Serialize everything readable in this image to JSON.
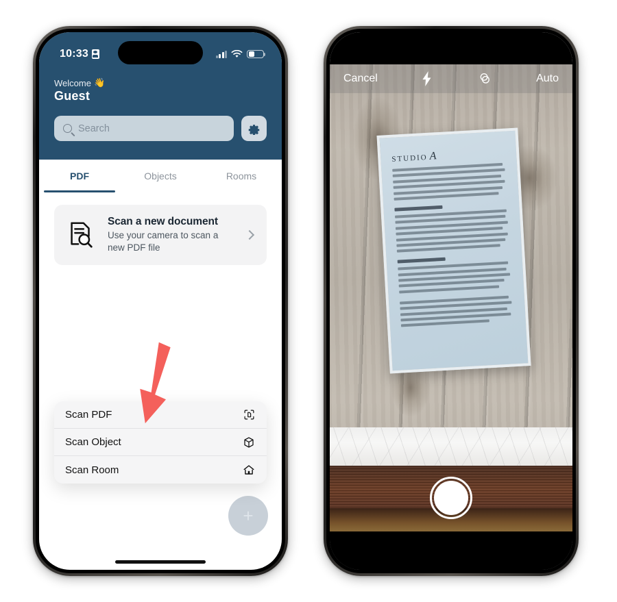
{
  "left_phone": {
    "status_bar": {
      "time": "10:33",
      "badge_icon": "id-badge-icon",
      "signal_icon": "cellular-signal-icon",
      "wifi_icon": "wifi-icon",
      "battery_icon": "battery-icon"
    },
    "header": {
      "welcome_label": "Welcome",
      "wave_emoji": "👋",
      "user_name": "Guest",
      "background_color": "#27506F"
    },
    "search": {
      "placeholder": "Search",
      "icon": "search-icon"
    },
    "settings_button": {
      "icon": "gear-icon"
    },
    "tabs": [
      {
        "label": "PDF",
        "active": true
      },
      {
        "label": "Objects",
        "active": false
      },
      {
        "label": "Rooms",
        "active": false
      }
    ],
    "scan_card": {
      "icon": "document-search-icon",
      "title": "Scan a new document",
      "subtitle": "Use your camera to scan a new PDF file",
      "chevron_icon": "chevron-right-icon"
    },
    "fab": {
      "icon": "plus-icon",
      "label": "+"
    },
    "context_menu": [
      {
        "label": "Scan PDF",
        "icon": "document-viewfinder-icon"
      },
      {
        "label": "Scan Object",
        "icon": "cube-box-icon"
      },
      {
        "label": "Scan Room",
        "icon": "house-icon"
      }
    ],
    "annotation": {
      "arrow_icon": "red-arrow-down-icon",
      "color": "#F4605B"
    }
  },
  "right_phone": {
    "camera_toolbar": {
      "cancel_label": "Cancel",
      "flash_icon": "flash-bolt-icon",
      "filter_icon": "color-filter-icon",
      "mode_label": "Auto"
    },
    "shutter_button": {
      "icon": "shutter-icon"
    },
    "scene": {
      "background": "wooden-planks",
      "document": {
        "brand_prefix": "STUDIO",
        "brand_letter": "A"
      }
    }
  }
}
